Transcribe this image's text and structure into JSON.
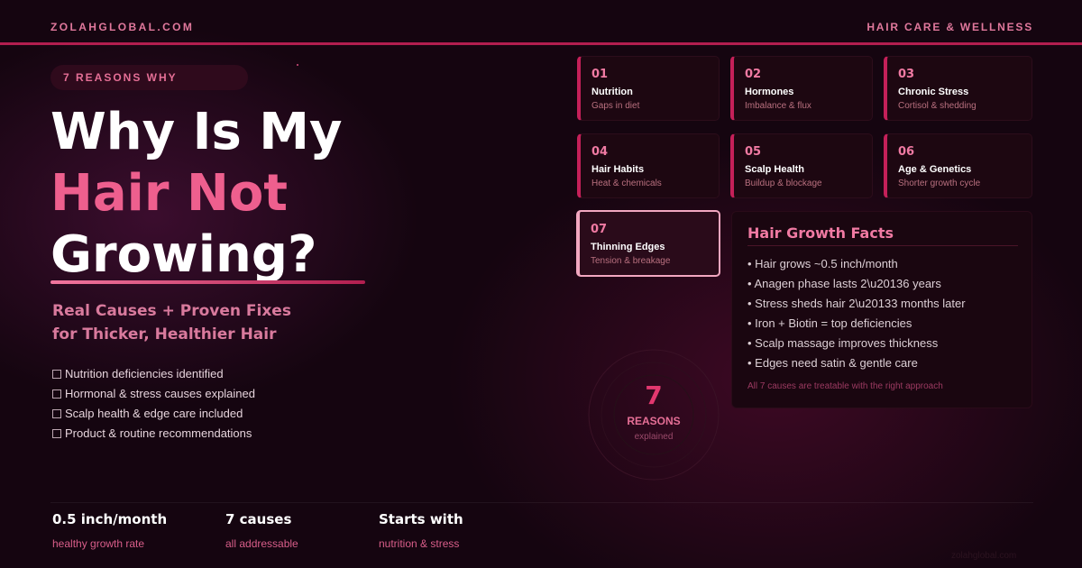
{
  "header": {
    "site": "ZOLAHGLOBAL.COM",
    "section": "HAIR CARE & WELLNESS"
  },
  "hero": {
    "pill": "7 REASONS WHY",
    "title_line1": "Why Is My",
    "title_line2": "Hair Not",
    "title_line3": "Growing?",
    "subtitle_line1": "Real Causes + Proven Fixes",
    "subtitle_line2": "for Thicker, Healthier Hair",
    "features": [
      "Nutrition deficiencies identified",
      "Hormonal & stress causes explained",
      "Scalp health & edge care included",
      "Product & routine recommendations"
    ]
  },
  "stats": [
    {
      "value": "0.5 inch/month",
      "label": "healthy growth rate"
    },
    {
      "value": "7 causes",
      "label": "all addressable"
    },
    {
      "value": "Starts with",
      "label": "nutrition & stress"
    }
  ],
  "reasons": [
    {
      "num": "01",
      "title": "Nutrition",
      "sub": "Gaps in diet"
    },
    {
      "num": "02",
      "title": "Hormones",
      "sub": "Imbalance & flux"
    },
    {
      "num": "03",
      "title": "Chronic Stress",
      "sub": "Cortisol & shedding"
    },
    {
      "num": "04",
      "title": "Hair Habits",
      "sub": "Heat & chemicals"
    },
    {
      "num": "05",
      "title": "Scalp Health",
      "sub": "Buildup & blockage"
    },
    {
      "num": "06",
      "title": "Age & Genetics",
      "sub": "Shorter growth cycle"
    },
    {
      "num": "07",
      "title": "Thinning Edges",
      "sub": "Tension & breakage"
    }
  ],
  "facts": {
    "title": "Hair Growth Facts",
    "items": [
      "• Hair grows ~0.5 inch/month",
      "• Anagen phase lasts 2\\u20136 years",
      "• Stress sheds hair 2\\u20133 months later",
      "• Iron + Biotin = top deficiencies",
      "• Scalp massage improves thickness",
      "• Edges need satin & gentle care"
    ],
    "footnote": "All 7 causes are treatable with the right approach"
  },
  "counter": {
    "number": "7",
    "word": "REASONS",
    "sub": "explained"
  },
  "watermark": "zolahglobal.com",
  "colors": {
    "accent": "#e2386f",
    "pink": "#ee5f8e",
    "background": "#150510"
  }
}
